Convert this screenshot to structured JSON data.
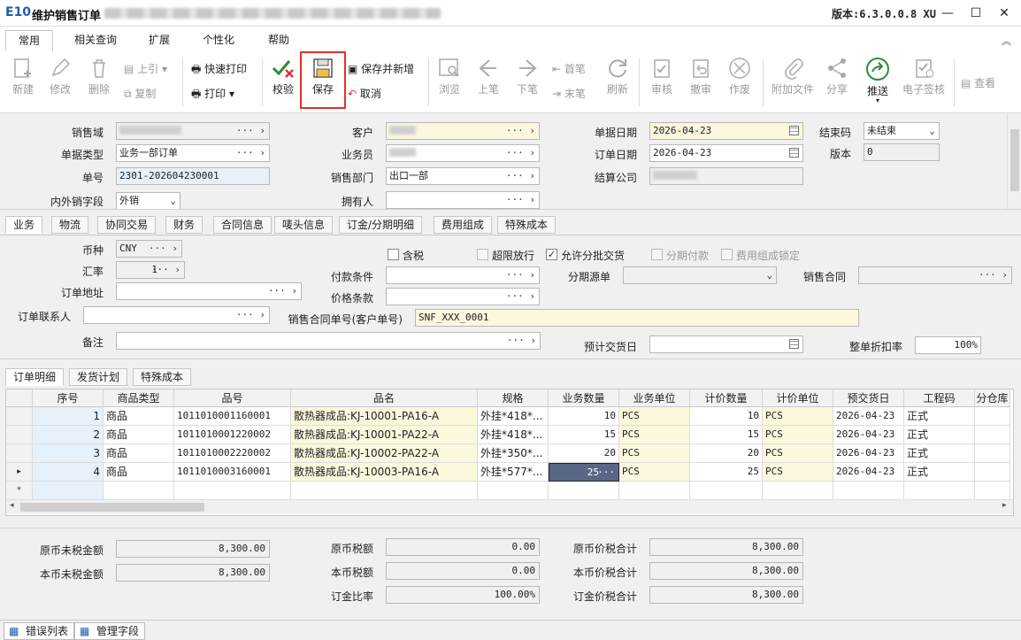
{
  "window": {
    "logo": "E10",
    "title": "维护销售订单",
    "version": "版本:6.3.0.0.8 XU",
    "min": "—",
    "max": "☐",
    "close": "✕"
  },
  "menu": {
    "tabs": [
      "常用",
      "相关查询",
      "扩展",
      "个性化",
      "帮助"
    ],
    "collapse": "︽"
  },
  "ribbon": {
    "new": "新建",
    "edit": "修改",
    "delete": "删除",
    "prev_up": "上引",
    "copy": "复制",
    "quick_print": "快速打印",
    "print": "打印",
    "check": "校验",
    "save": "保存",
    "save_new": "保存并新增",
    "cancel": "取消",
    "browse": "浏览",
    "prev": "上笔",
    "next": "下笔",
    "first": "首笔",
    "last": "末笔",
    "refresh": "刷新",
    "audit": "审核",
    "unaudit": "撤审",
    "void": "作废",
    "attach": "附加文件",
    "share": "分享",
    "push": "推送",
    "esign": "电子签核",
    "view": "查看"
  },
  "header": {
    "sales_domain": {
      "label": "销售域"
    },
    "doc_type": {
      "label": "单据类型",
      "value": "业务一部订单"
    },
    "doc_no": {
      "label": "单号",
      "value": "2301-202604230001"
    },
    "domestic": {
      "label": "内外销字段",
      "value": "外销"
    },
    "customer": {
      "label": "客户"
    },
    "salesman": {
      "label": "业务员"
    },
    "sales_dept": {
      "label": "销售部门",
      "value": "出口一部"
    },
    "owner": {
      "label": "拥有人"
    },
    "doc_date": {
      "label": "单据日期",
      "value": "2026-04-23"
    },
    "order_date": {
      "label": "订单日期",
      "value": "2026-04-23"
    },
    "settle_company": {
      "label": "结算公司"
    },
    "close_code": {
      "label": "结束码",
      "value": "未结束"
    },
    "version": {
      "label": "版本",
      "value": "0"
    }
  },
  "detail_tabs": [
    "业务",
    "物流",
    "协同交易",
    "财务",
    "合同信息",
    "唛头信息",
    "订金/分期明细",
    "费用组成",
    "特殊成本"
  ],
  "business": {
    "currency": {
      "label": "币种",
      "value": "CNY"
    },
    "rate": {
      "label": "汇率",
      "value": "1"
    },
    "order_address": {
      "label": "订单地址"
    },
    "order_contact": {
      "label": "订单联系人"
    },
    "remark": {
      "label": "备注"
    },
    "tax_incl": "含税",
    "over_limit": "超限放行",
    "allow_batch": "允许分批交货",
    "installment": "分期付款",
    "fee_lock": "费用组成锁定",
    "payment_terms": {
      "label": "付款条件"
    },
    "price_terms": {
      "label": "价格条款"
    },
    "contract_no": {
      "label": "销售合同单号(客户单号)",
      "value": "SNF_XXX_0001"
    },
    "installment_src": {
      "label": "分期源单"
    },
    "sales_contract": {
      "label": "销售合同"
    },
    "est_delivery": {
      "label": "预计交货日"
    },
    "discount": {
      "label": "整单折扣率",
      "value": "100%"
    }
  },
  "grid_tabs": [
    "订单明细",
    "发货计划",
    "特殊成本"
  ],
  "grid": {
    "columns": [
      "序号",
      "商品类型",
      "品号",
      "品名",
      "规格",
      "业务数量",
      "业务单位",
      "计价数量",
      "计价单位",
      "预交货日",
      "工程码",
      "分仓库"
    ],
    "rows": [
      {
        "seq": "1",
        "type": "商品",
        "code": "1011010001160001",
        "name": "散热器成品:KJ-10001-PA16-A",
        "spec": "外挂*418*...",
        "qty": "10",
        "unit": "PCS",
        "pqty": "10",
        "punit": "PCS",
        "date": "2026-04-23",
        "proj": "正式"
      },
      {
        "seq": "2",
        "type": "商品",
        "code": "1011010001220002",
        "name": "散热器成品:KJ-10001-PA22-A",
        "spec": "外挂*418*...",
        "qty": "15",
        "unit": "PCS",
        "pqty": "15",
        "punit": "PCS",
        "date": "2026-04-23",
        "proj": "正式"
      },
      {
        "seq": "3",
        "type": "商品",
        "code": "1011010002220002",
        "name": "散热器成品:KJ-10002-PA22-A",
        "spec": "外挂*350*...",
        "qty": "20",
        "unit": "PCS",
        "pqty": "20",
        "punit": "PCS",
        "date": "2026-04-23",
        "proj": "正式"
      },
      {
        "seq": "4",
        "type": "商品",
        "code": "1011010003160001",
        "name": "散热器成品:KJ-10003-PA16-A",
        "spec": "外挂*577*...",
        "qty": "25",
        "unit": "PCS",
        "pqty": "25",
        "punit": "PCS",
        "date": "2026-04-23",
        "proj": "正式"
      }
    ],
    "new_row_marker": "*",
    "current_row_marker": "▸"
  },
  "totals": {
    "orig_untaxed": {
      "label": "原币未税金额",
      "value": "8,300.00"
    },
    "local_untaxed": {
      "label": "本币未税金额",
      "value": "8,300.00"
    },
    "orig_tax": {
      "label": "原币税额",
      "value": "0.00"
    },
    "local_tax": {
      "label": "本币税额",
      "value": "0.00"
    },
    "deposit_ratio": {
      "label": "订金比率",
      "value": "100.00%"
    },
    "orig_total": {
      "label": "原币价税合计",
      "value": "8,300.00"
    },
    "local_total": {
      "label": "本币价税合计",
      "value": "8,300.00"
    },
    "deposit_total": {
      "label": "订金价税合计",
      "value": "8,300.00"
    }
  },
  "bottom": {
    "errors": "错误列表",
    "manage": "管理字段"
  },
  "colors": {
    "accent": "#1f5fa8",
    "highlight_red": "#e0302a",
    "yellow_field": "#fbf8de",
    "blue_field": "#e6f1fb"
  }
}
